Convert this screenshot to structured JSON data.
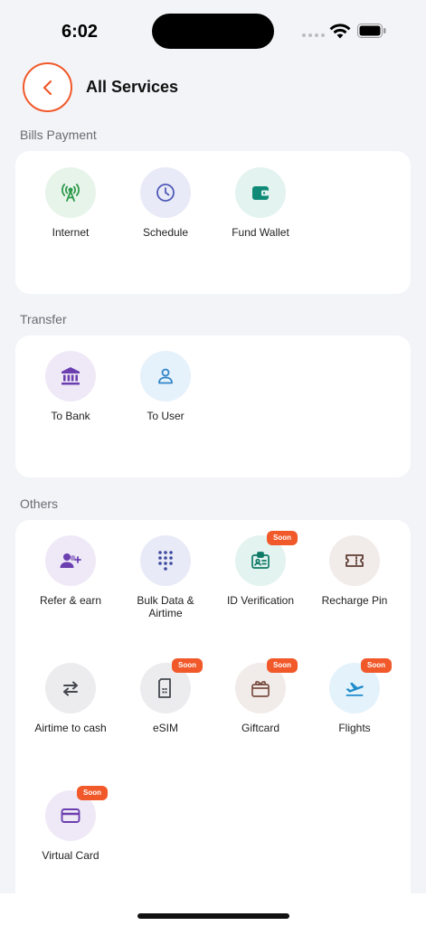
{
  "status": {
    "time": "6:02"
  },
  "header": {
    "title": "All Services"
  },
  "sections": {
    "bills": {
      "label": "Bills Payment",
      "items": [
        {
          "label": "Internet",
          "icon": "antenna-icon",
          "bg": "#e7f4ea",
          "fg": "#2f9a4c"
        },
        {
          "label": "Schedule",
          "icon": "clock-icon",
          "bg": "#e8eaf7",
          "fg": "#4f5ab8"
        },
        {
          "label": "Fund Wallet",
          "icon": "wallet-icon",
          "bg": "#e3f3f0",
          "fg": "#0e8a76"
        }
      ]
    },
    "transfer": {
      "label": "Transfer",
      "items": [
        {
          "label": "To Bank",
          "icon": "bank-icon",
          "bg": "#efe9f7",
          "fg": "#6b3fb0"
        },
        {
          "label": "To User",
          "icon": "user-icon",
          "bg": "#e5f1fb",
          "fg": "#2f85c8"
        }
      ]
    },
    "others": {
      "label": "Others",
      "soon": "Soon",
      "items": [
        {
          "label": "Refer & earn",
          "icon": "refer-icon",
          "bg": "#efe9f7",
          "fg": "#6b3fb0"
        },
        {
          "label": "Bulk Data & Airtime",
          "icon": "keypad-icon",
          "bg": "#e8eaf7",
          "fg": "#3c4a9e"
        },
        {
          "label": "ID Verification",
          "icon": "id-card-icon",
          "bg": "#e3f3f0",
          "fg": "#0e7a66"
        },
        {
          "label": "Recharge Pin",
          "icon": "ticket-icon",
          "bg": "#f1ebe9",
          "fg": "#5e3d32"
        },
        {
          "label": "Airtime to cash",
          "icon": "swap-icon",
          "bg": "#ececee",
          "fg": "#44474d"
        },
        {
          "label": "eSIM",
          "icon": "sim-icon",
          "bg": "#ececee",
          "fg": "#44474d"
        },
        {
          "label": "Giftcard",
          "icon": "gift-icon",
          "bg": "#f1ebe9",
          "fg": "#7a4e42"
        },
        {
          "label": "Flights",
          "icon": "plane-icon",
          "bg": "#e3f2fb",
          "fg": "#1f8ccb"
        },
        {
          "label": "Virtual Card",
          "icon": "card-icon",
          "bg": "#efe9f7",
          "fg": "#6b3fb0"
        }
      ]
    }
  },
  "colors": {
    "accent": "#f1592a",
    "background": "#f3f4f8",
    "card": "#ffffff"
  }
}
